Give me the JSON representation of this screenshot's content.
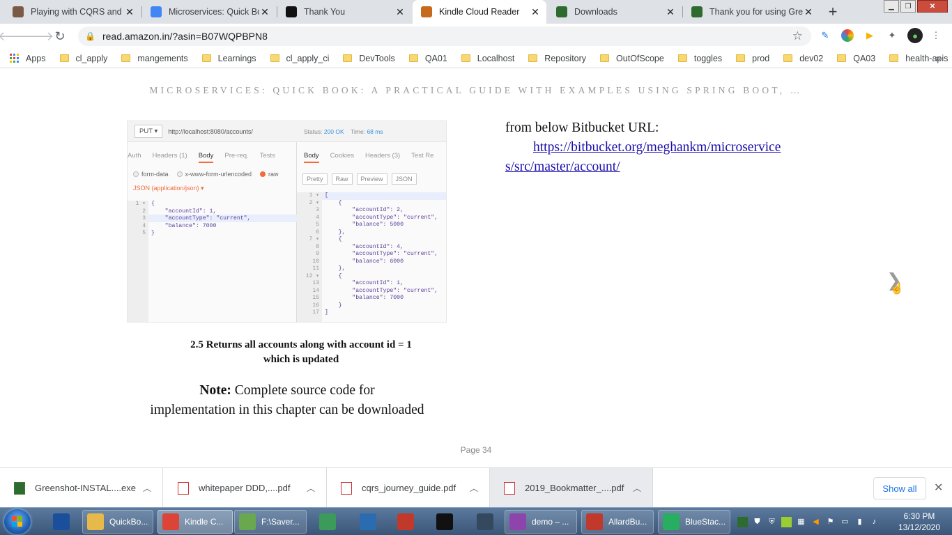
{
  "browser": {
    "tabs": [
      {
        "title": "Playing with CQRS and E",
        "icon": "avatar-favicon",
        "color": "#7b5a45"
      },
      {
        "title": "Microservices: Quick Boo",
        "icon": "google-favicon",
        "color": "#4285f4"
      },
      {
        "title": "Thank You",
        "icon": "amazon-favicon",
        "color": "#111111"
      },
      {
        "title": "Kindle Cloud Reader",
        "icon": "kindle-favicon",
        "color": "#c66a1d"
      },
      {
        "title": "Downloads",
        "icon": "greenshot-favicon",
        "color": "#2e6b2e"
      },
      {
        "title": "Thank you for using Gre",
        "icon": "greenshot-favicon",
        "color": "#2e6b2e"
      }
    ],
    "active_tab": 3,
    "new_tab_symbol": "+",
    "close_symbol": "✕",
    "url": "read.amazon.in/?asin=B07WQPBPN8",
    "bookmarks": [
      {
        "label": "Apps",
        "type": "apps"
      },
      {
        "label": "cl_apply",
        "type": "folder"
      },
      {
        "label": "mangements",
        "type": "folder"
      },
      {
        "label": "Learnings",
        "type": "folder"
      },
      {
        "label": "cl_apply_ci",
        "type": "folder"
      },
      {
        "label": "DevTools",
        "type": "folder"
      },
      {
        "label": "QA01",
        "type": "folder"
      },
      {
        "label": "Localhost",
        "type": "folder"
      },
      {
        "label": "Repository",
        "type": "folder"
      },
      {
        "label": "OutOfScope",
        "type": "folder"
      },
      {
        "label": "toggles",
        "type": "folder"
      },
      {
        "label": "prod",
        "type": "folder"
      },
      {
        "label": "dev02",
        "type": "folder"
      },
      {
        "label": "QA03",
        "type": "folder"
      },
      {
        "label": "health-apis",
        "type": "folder"
      }
    ],
    "bookmarks_more": "»"
  },
  "reader": {
    "book_title": "MICROSERVICES: QUICK BOOK: A PRACTICAL GUIDE WITH EXAMPLES USING SPRING BOOT, …",
    "figure": {
      "method": "PUT",
      "url": "http://localhost:8080/accounts/",
      "status_label": "Status:",
      "status": "200 OK",
      "time_label": "Time:",
      "time": "68 ms",
      "req_tabs": [
        "Auth",
        "Headers (1)",
        "Body",
        "Pre-req.",
        "Tests"
      ],
      "body_options": [
        "form-data",
        "x-www-form-urlencoded",
        "raw"
      ],
      "content_type": "JSON (application/json)",
      "res_tabs": [
        "Body",
        "Cookies",
        "Headers (3)",
        "Test Re"
      ],
      "res_view": [
        "Pretty",
        "Raw",
        "Preview",
        "JSON"
      ],
      "request_gutter": "1 ▾\n2\n3\n4\n5",
      "request_code": "{\n    \"accountId\": 1,\n    \"accountType\": \"current\",\n    \"balance\": 7000\n}",
      "response_gutter": "1 ▾\n2 ▾\n3\n4\n5\n6\n7 ▾\n8\n9\n10\n11\n12 ▾\n13\n14\n15\n16\n17",
      "response_code": "[\n    {\n        \"accountId\": 2,\n        \"accountType\": \"current\",\n        \"balance\": 5000\n    },\n    {\n        \"accountId\": 4,\n        \"accountType\": \"current\",\n        \"balance\": 6000\n    },\n    {\n        \"accountId\": 1,\n        \"accountType\": \"current\",\n        \"balance\": 7000\n    }\n]"
    },
    "caption_line1": "2.5 Returns all accounts along with account id = 1",
    "caption_line2": "which is updated",
    "note_label": "Note:",
    "note_text_1": " Complete source code for",
    "note_text_2": "implementation in this chapter can be downloaded",
    "right_text": "from below Bitbucket URL:",
    "link_line1": "https://bitbucket.org/meghankm/microservice",
    "link_line2": "s/src/master/account/",
    "next_symbol": "❯",
    "page_label": "Page 34"
  },
  "downloads": {
    "items": [
      {
        "name": "Greenshot-INSTAL....exe",
        "type": "exe"
      },
      {
        "name": "whitepaper DDD,....pdf",
        "type": "pdf"
      },
      {
        "name": "cqrs_journey_guide.pdf",
        "type": "pdf"
      },
      {
        "name": "2019_Bookmatter_....pdf",
        "type": "pdf"
      }
    ],
    "show_all": "Show all",
    "close_symbol": "✕"
  },
  "taskbar": {
    "apps": [
      {
        "label": "",
        "icon": "app-icon",
        "color": "#1b4f9c"
      },
      {
        "label": "QuickBo...",
        "icon": "folder-icon",
        "color": "#e7b84a"
      },
      {
        "label": "Kindle C...",
        "icon": "chrome-icon",
        "color": "#db4437"
      },
      {
        "label": "F:\\Saver...",
        "icon": "notepad-icon",
        "color": "#6aa84f"
      },
      {
        "label": "",
        "icon": "clock-icon",
        "color": "#3c9b5a"
      },
      {
        "label": "",
        "icon": "editor-icon",
        "color": "#2b6cb0"
      },
      {
        "label": "",
        "icon": "snipping-icon",
        "color": "#c0392b"
      },
      {
        "label": "",
        "icon": "cmd-icon",
        "color": "#111111"
      },
      {
        "label": "",
        "icon": "document-icon",
        "color": "#34495e"
      },
      {
        "label": "demo – ...",
        "icon": "intellij-icon",
        "color": "#8e44ad"
      },
      {
        "label": "AllardBu...",
        "icon": "pdf-icon",
        "color": "#c0392b"
      },
      {
        "label": "BlueStac...",
        "icon": "bluestacks-icon",
        "color": "#27ae60"
      }
    ],
    "time": "6:30 PM",
    "date": "13/12/2020"
  }
}
